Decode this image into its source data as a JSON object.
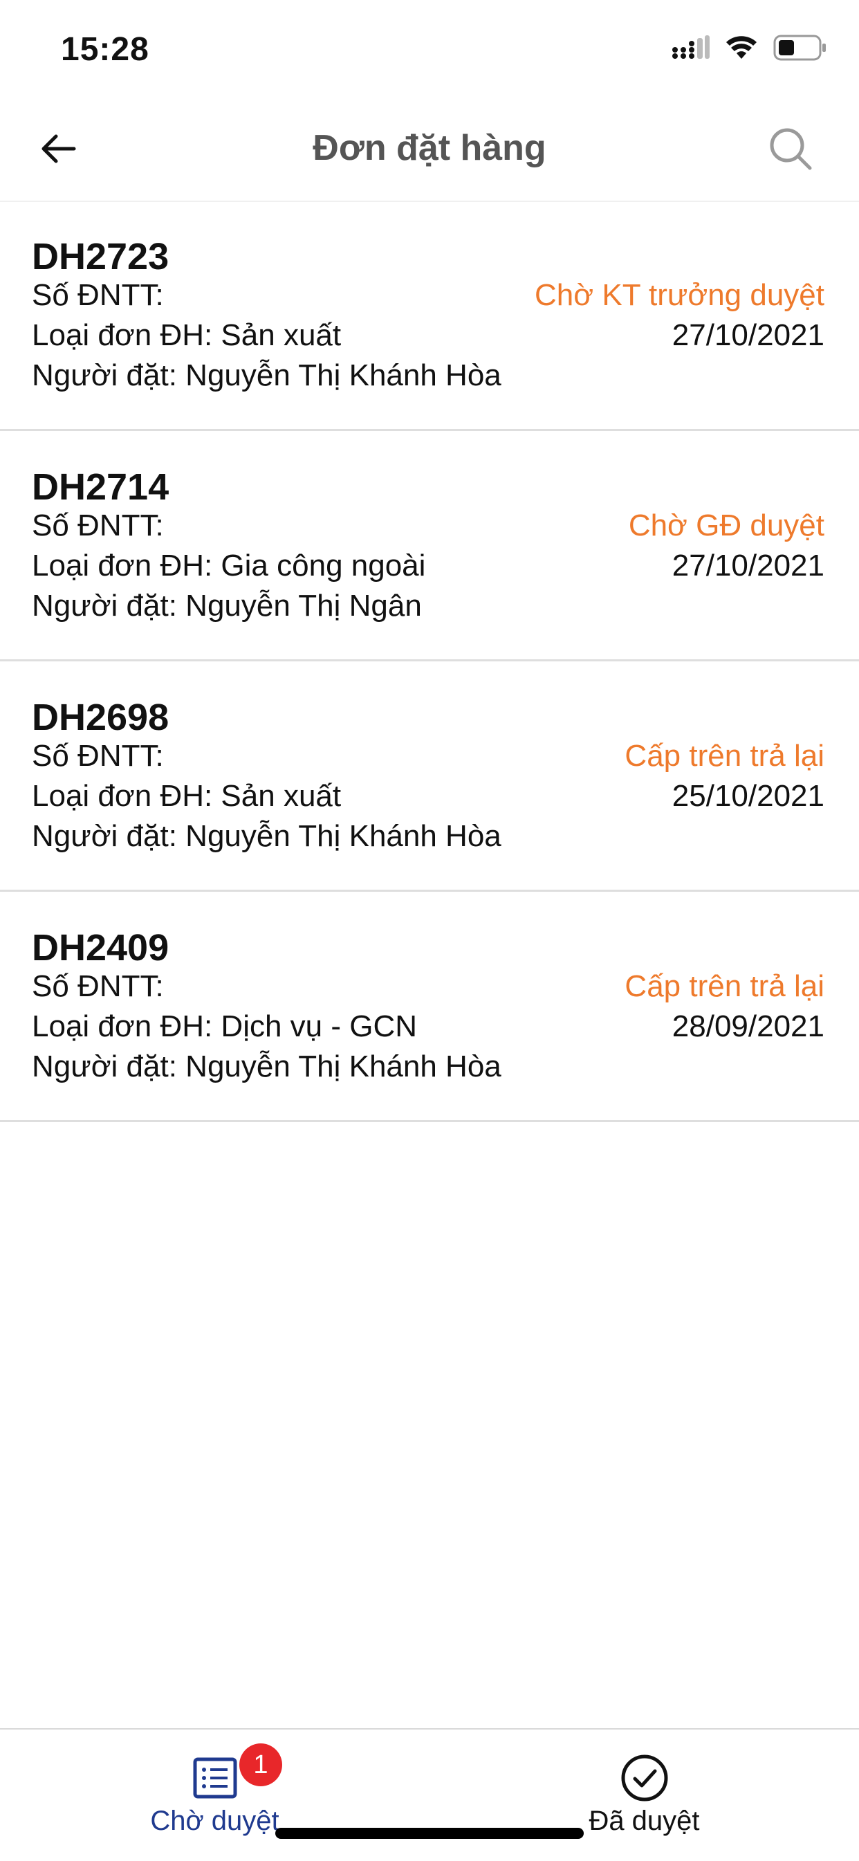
{
  "status_bar": {
    "time": "15:28"
  },
  "header": {
    "title": "Đơn đặt hàng",
    "back_icon": "arrow-left-icon",
    "search_icon": "search-icon"
  },
  "orders": [
    {
      "id": "DH2723",
      "dntt_label": "Số ĐNTT:",
      "type_label": "Loại đơn ĐH: Sản xuất",
      "orderer_label": "Người đặt: Nguyễn Thị Khánh Hòa",
      "status": "Chờ KT trưởng duyệt",
      "date": "27/10/2021"
    },
    {
      "id": "DH2714",
      "dntt_label": "Số ĐNTT:",
      "type_label": "Loại đơn ĐH: Gia công ngoài",
      "orderer_label": "Người đặt: Nguyễn Thị Ngân",
      "status": "Chờ GĐ duyệt",
      "date": "27/10/2021"
    },
    {
      "id": "DH2698",
      "dntt_label": "Số ĐNTT:",
      "type_label": "Loại đơn ĐH: Sản xuất",
      "orderer_label": "Người đặt: Nguyễn Thị Khánh Hòa",
      "status": "Cấp trên trả lại",
      "date": "25/10/2021"
    },
    {
      "id": "DH2409",
      "dntt_label": "Số ĐNTT:",
      "type_label": "Loại đơn ĐH: Dịch vụ - GCN",
      "orderer_label": "Người đặt: Nguyễn Thị Khánh Hòa",
      "status": "Cấp trên trả lại",
      "date": "28/09/2021"
    }
  ],
  "tab_bar": {
    "pending_label": "Chờ duyệt",
    "pending_badge": "1",
    "approved_label": "Đã duyệt",
    "pending_icon": "list-icon",
    "approved_icon": "check-circle-icon"
  },
  "colors": {
    "status_orange": "#EE7A2C",
    "active_tab_blue": "#1F3A8F",
    "badge_red": "#E8272A",
    "title_gray": "#555555"
  }
}
